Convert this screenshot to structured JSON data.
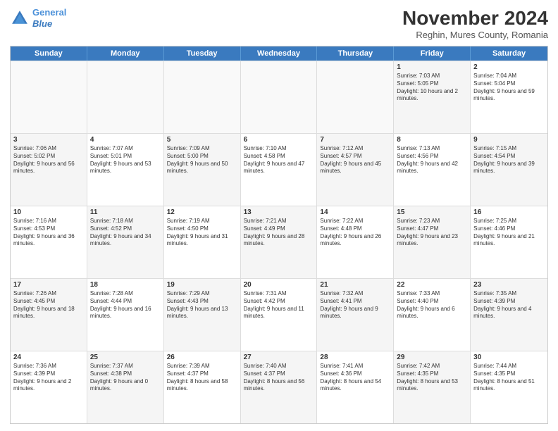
{
  "header": {
    "logo_line1": "General",
    "logo_line2": "Blue",
    "month": "November 2024",
    "location": "Reghin, Mures County, Romania"
  },
  "days_of_week": [
    "Sunday",
    "Monday",
    "Tuesday",
    "Wednesday",
    "Thursday",
    "Friday",
    "Saturday"
  ],
  "weeks": [
    [
      {
        "day": "",
        "info": "",
        "empty": true
      },
      {
        "day": "",
        "info": "",
        "empty": true
      },
      {
        "day": "",
        "info": "",
        "empty": true
      },
      {
        "day": "",
        "info": "",
        "empty": true
      },
      {
        "day": "",
        "info": "",
        "empty": true
      },
      {
        "day": "1",
        "info": "Sunrise: 7:03 AM\nSunset: 5:05 PM\nDaylight: 10 hours and 2 minutes.",
        "shaded": true
      },
      {
        "day": "2",
        "info": "Sunrise: 7:04 AM\nSunset: 5:04 PM\nDaylight: 9 hours and 59 minutes.",
        "shaded": false
      }
    ],
    [
      {
        "day": "3",
        "info": "Sunrise: 7:06 AM\nSunset: 5:02 PM\nDaylight: 9 hours and 56 minutes.",
        "shaded": true
      },
      {
        "day": "4",
        "info": "Sunrise: 7:07 AM\nSunset: 5:01 PM\nDaylight: 9 hours and 53 minutes.",
        "shaded": false
      },
      {
        "day": "5",
        "info": "Sunrise: 7:09 AM\nSunset: 5:00 PM\nDaylight: 9 hours and 50 minutes.",
        "shaded": true
      },
      {
        "day": "6",
        "info": "Sunrise: 7:10 AM\nSunset: 4:58 PM\nDaylight: 9 hours and 47 minutes.",
        "shaded": false
      },
      {
        "day": "7",
        "info": "Sunrise: 7:12 AM\nSunset: 4:57 PM\nDaylight: 9 hours and 45 minutes.",
        "shaded": true
      },
      {
        "day": "8",
        "info": "Sunrise: 7:13 AM\nSunset: 4:56 PM\nDaylight: 9 hours and 42 minutes.",
        "shaded": false
      },
      {
        "day": "9",
        "info": "Sunrise: 7:15 AM\nSunset: 4:54 PM\nDaylight: 9 hours and 39 minutes.",
        "shaded": true
      }
    ],
    [
      {
        "day": "10",
        "info": "Sunrise: 7:16 AM\nSunset: 4:53 PM\nDaylight: 9 hours and 36 minutes.",
        "shaded": false
      },
      {
        "day": "11",
        "info": "Sunrise: 7:18 AM\nSunset: 4:52 PM\nDaylight: 9 hours and 34 minutes.",
        "shaded": true
      },
      {
        "day": "12",
        "info": "Sunrise: 7:19 AM\nSunset: 4:50 PM\nDaylight: 9 hours and 31 minutes.",
        "shaded": false
      },
      {
        "day": "13",
        "info": "Sunrise: 7:21 AM\nSunset: 4:49 PM\nDaylight: 9 hours and 28 minutes.",
        "shaded": true
      },
      {
        "day": "14",
        "info": "Sunrise: 7:22 AM\nSunset: 4:48 PM\nDaylight: 9 hours and 26 minutes.",
        "shaded": false
      },
      {
        "day": "15",
        "info": "Sunrise: 7:23 AM\nSunset: 4:47 PM\nDaylight: 9 hours and 23 minutes.",
        "shaded": true
      },
      {
        "day": "16",
        "info": "Sunrise: 7:25 AM\nSunset: 4:46 PM\nDaylight: 9 hours and 21 minutes.",
        "shaded": false
      }
    ],
    [
      {
        "day": "17",
        "info": "Sunrise: 7:26 AM\nSunset: 4:45 PM\nDaylight: 9 hours and 18 minutes.",
        "shaded": true
      },
      {
        "day": "18",
        "info": "Sunrise: 7:28 AM\nSunset: 4:44 PM\nDaylight: 9 hours and 16 minutes.",
        "shaded": false
      },
      {
        "day": "19",
        "info": "Sunrise: 7:29 AM\nSunset: 4:43 PM\nDaylight: 9 hours and 13 minutes.",
        "shaded": true
      },
      {
        "day": "20",
        "info": "Sunrise: 7:31 AM\nSunset: 4:42 PM\nDaylight: 9 hours and 11 minutes.",
        "shaded": false
      },
      {
        "day": "21",
        "info": "Sunrise: 7:32 AM\nSunset: 4:41 PM\nDaylight: 9 hours and 9 minutes.",
        "shaded": true
      },
      {
        "day": "22",
        "info": "Sunrise: 7:33 AM\nSunset: 4:40 PM\nDaylight: 9 hours and 6 minutes.",
        "shaded": false
      },
      {
        "day": "23",
        "info": "Sunrise: 7:35 AM\nSunset: 4:39 PM\nDaylight: 9 hours and 4 minutes.",
        "shaded": true
      }
    ],
    [
      {
        "day": "24",
        "info": "Sunrise: 7:36 AM\nSunset: 4:39 PM\nDaylight: 9 hours and 2 minutes.",
        "shaded": false
      },
      {
        "day": "25",
        "info": "Sunrise: 7:37 AM\nSunset: 4:38 PM\nDaylight: 9 hours and 0 minutes.",
        "shaded": true
      },
      {
        "day": "26",
        "info": "Sunrise: 7:39 AM\nSunset: 4:37 PM\nDaylight: 8 hours and 58 minutes.",
        "shaded": false
      },
      {
        "day": "27",
        "info": "Sunrise: 7:40 AM\nSunset: 4:37 PM\nDaylight: 8 hours and 56 minutes.",
        "shaded": true
      },
      {
        "day": "28",
        "info": "Sunrise: 7:41 AM\nSunset: 4:36 PM\nDaylight: 8 hours and 54 minutes.",
        "shaded": false
      },
      {
        "day": "29",
        "info": "Sunrise: 7:42 AM\nSunset: 4:35 PM\nDaylight: 8 hours and 53 minutes.",
        "shaded": true
      },
      {
        "day": "30",
        "info": "Sunrise: 7:44 AM\nSunset: 4:35 PM\nDaylight: 8 hours and 51 minutes.",
        "shaded": false
      }
    ]
  ]
}
